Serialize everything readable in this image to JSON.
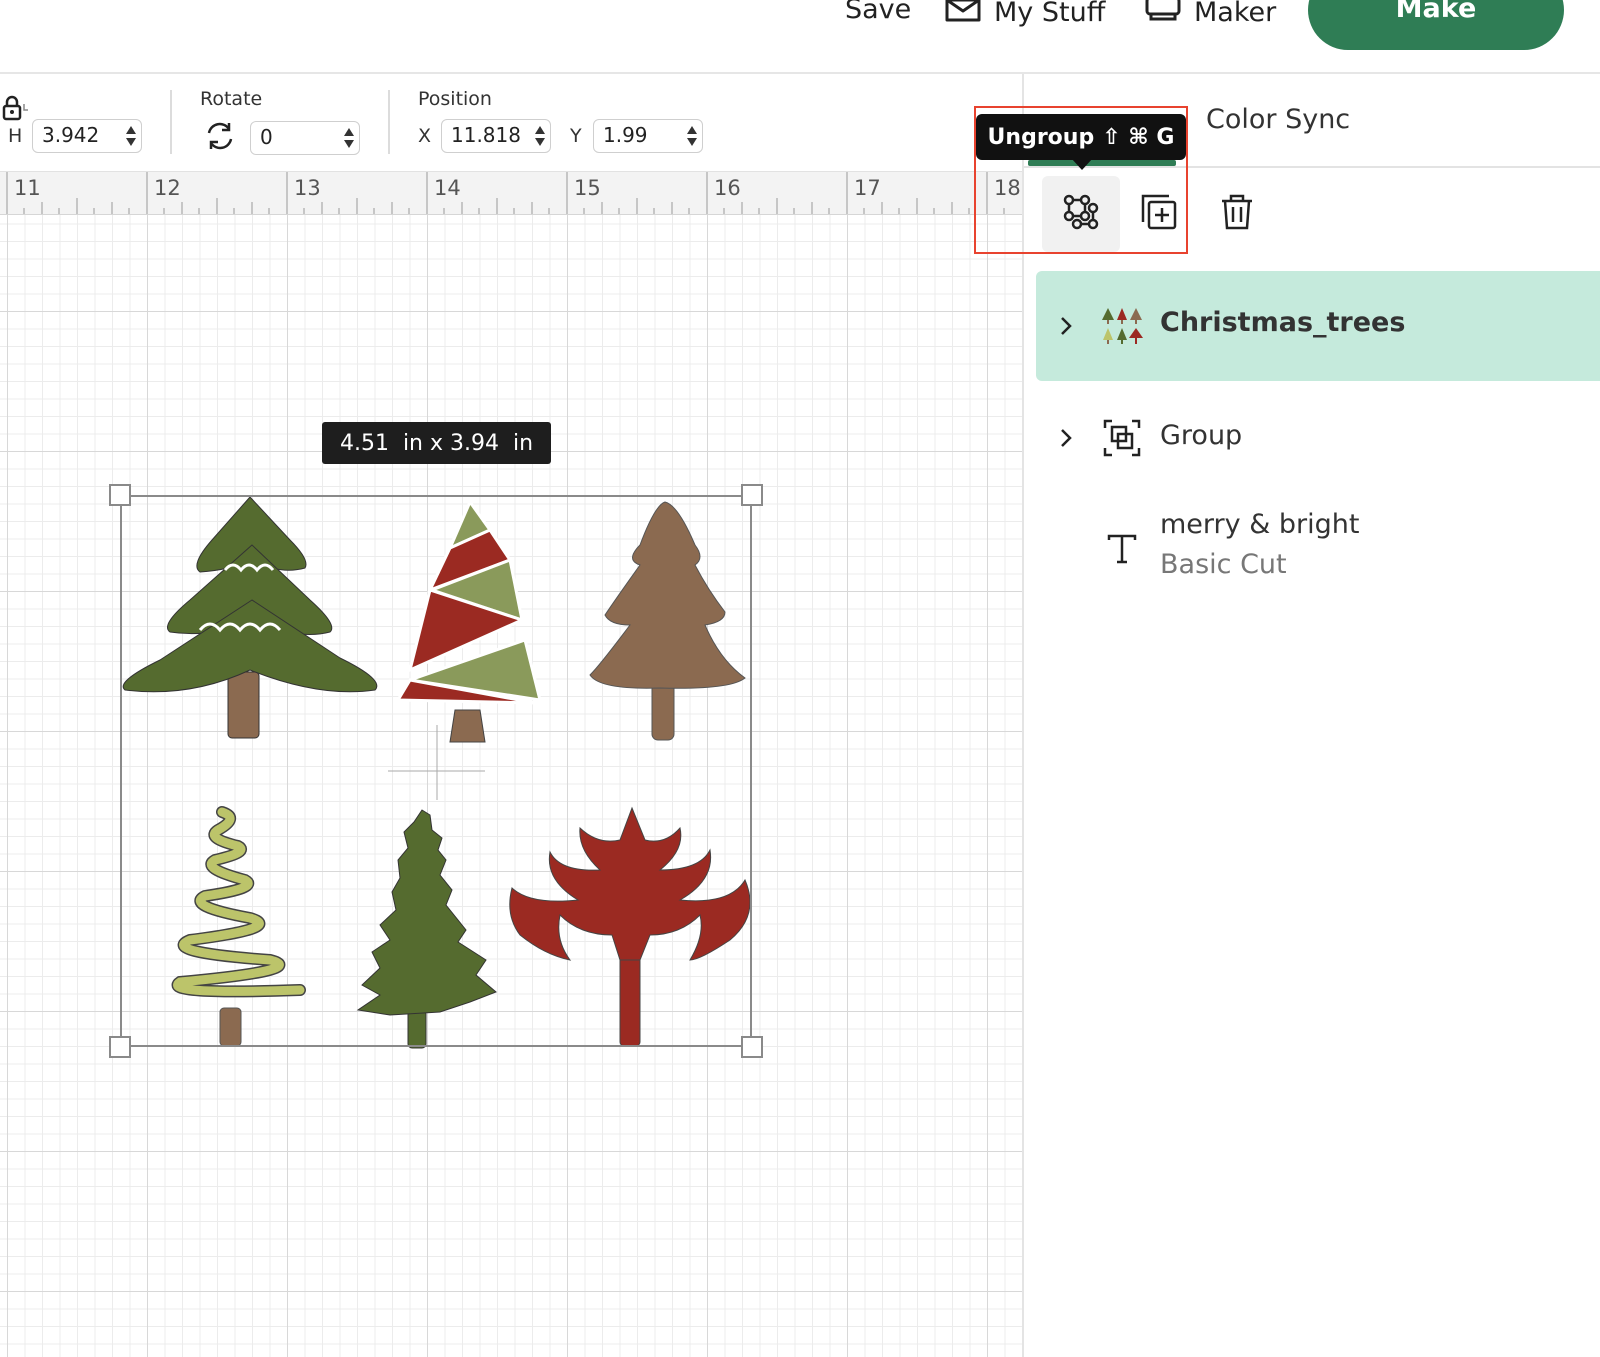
{
  "topbar": {
    "save_label": "Save",
    "mystuff_label": "My Stuff",
    "maker_label": "Maker",
    "make_label": "Make"
  },
  "editbar": {
    "h_label": "H",
    "h_value": "3.942",
    "rotate_label": "Rotate",
    "rotate_value": "0",
    "position_label": "Position",
    "x_label": "X",
    "x_value": "11.818",
    "y_label": "Y",
    "y_value": "1.99"
  },
  "ruler": {
    "labels": [
      "11",
      "12",
      "13",
      "14",
      "15",
      "16",
      "17",
      "18"
    ]
  },
  "canvas": {
    "size_tooltip": "4.51  in x 3.94  in"
  },
  "panel": {
    "color_sync_label": "Color Sync",
    "tooltip_label": "Ungroup",
    "tooltip_shortcut": "⇧ ⌘ G",
    "layers": [
      {
        "name": "Christmas_trees",
        "icon": "christmas-trees-thumbnail",
        "selected": true
      },
      {
        "name": "Group",
        "icon": "group-icon",
        "selected": false
      },
      {
        "name": "merry & bright",
        "sub": "Basic Cut",
        "icon": "text-icon",
        "selected": false
      }
    ]
  },
  "colors": {
    "accent": "#2f7d55",
    "selected_layer_bg": "#c5eadc",
    "highlight": "#e8432f",
    "tree_dark_green": "#556b2f",
    "tree_red": "#9b2a22",
    "tree_sage": "#8a9a5b",
    "tree_brown": "#8b6a50",
    "tree_light_green": "#bcc46a"
  }
}
